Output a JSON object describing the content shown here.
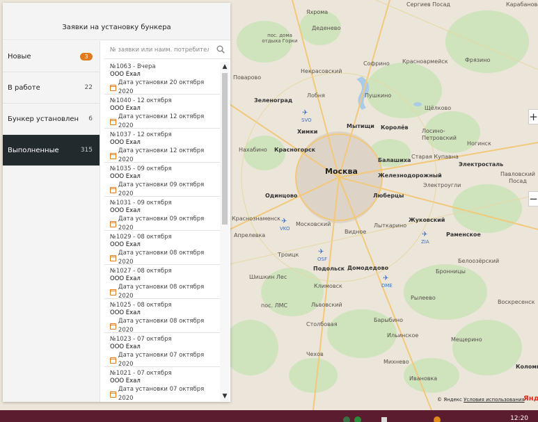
{
  "panel": {
    "title": "Заявки на установку бункера",
    "categories": [
      {
        "label": "Новые",
        "count": "3",
        "highlight": true
      },
      {
        "label": "В работе",
        "count": "22"
      },
      {
        "label": "Бункер установлен",
        "count": "6"
      },
      {
        "label": "Выполненные",
        "count": "315",
        "active": true
      }
    ],
    "search_placeholder": "№ заявки или наим. потребителя",
    "requests": [
      {
        "head": "№1063 - Вчера",
        "name": "ООО Exал",
        "date": "Дата установки 20 октября 2020"
      },
      {
        "head": "№1040 - 12 октября",
        "name": "ООО Exал",
        "date": "Дата установки 12 октября 2020"
      },
      {
        "head": "№1037 - 12 октября",
        "name": "ООО Exал",
        "date": "Дата установки 12 октября 2020"
      },
      {
        "head": "№1035 - 09 октября",
        "name": "ООО Exал",
        "date": "Дата установки 09 октября 2020"
      },
      {
        "head": "№1031 - 09 октября",
        "name": "ООО Exал",
        "date": "Дата установки 09 октября 2020"
      },
      {
        "head": "№1029 - 08 октября",
        "name": "ООО Exал",
        "date": "Дата установки 08 октября 2020"
      },
      {
        "head": "№1027 - 08 октября",
        "name": "ООО Exал",
        "date": "Дата установки 08 октября 2020"
      },
      {
        "head": "№1025 - 08 октября",
        "name": "ООО Exал",
        "date": "Дата установки 08 октября 2020"
      },
      {
        "head": "№1023 - 07 октября",
        "name": "ООО Exал",
        "date": "Дата установки 07 октября 2020"
      },
      {
        "head": "№1021 - 07 октября",
        "name": "ООО Exал",
        "date": "Дата установки 07 октября 2020"
      }
    ]
  },
  "map": {
    "labels": [
      {
        "text": "Яхрома",
        "cls": ""
      },
      {
        "text": "Сергиев Посад",
        "cls": ""
      },
      {
        "text": "Карабаново",
        "cls": ""
      },
      {
        "text": "Деденево",
        "cls": ""
      },
      {
        "text": "пос. дома отдыха Горки",
        "cls": ""
      },
      {
        "text": "Софрино",
        "cls": ""
      },
      {
        "text": "Красноармейск",
        "cls": ""
      },
      {
        "text": "Фрязино",
        "cls": ""
      },
      {
        "text": "Некрасовский",
        "cls": ""
      },
      {
        "text": "Поварово",
        "cls": ""
      },
      {
        "text": "Зеленоград",
        "cls": "town"
      },
      {
        "text": "Лобня",
        "cls": ""
      },
      {
        "text": "Пушкино",
        "cls": ""
      },
      {
        "text": "Щёлково",
        "cls": ""
      },
      {
        "text": "Химки",
        "cls": "town"
      },
      {
        "text": "Мытищи",
        "cls": "town"
      },
      {
        "text": "Королёв",
        "cls": "town"
      },
      {
        "text": "Лосино-Петровский",
        "cls": ""
      },
      {
        "text": "Ногинск",
        "cls": ""
      },
      {
        "text": "Нахабино",
        "cls": ""
      },
      {
        "text": "Красногорск",
        "cls": "town"
      },
      {
        "text": "Старая Купавна",
        "cls": ""
      },
      {
        "text": "Москва",
        "cls": "capital"
      },
      {
        "text": "Балашиха",
        "cls": "town"
      },
      {
        "text": "Электросталь",
        "cls": "town"
      },
      {
        "text": "Железнодорожный",
        "cls": "town"
      },
      {
        "text": "Электроугли",
        "cls": ""
      },
      {
        "text": "Павловский Посад",
        "cls": ""
      },
      {
        "text": "Одинцово",
        "cls": "town"
      },
      {
        "text": "Люберцы",
        "cls": "town"
      },
      {
        "text": "Краснознаменск",
        "cls": ""
      },
      {
        "text": "Московский",
        "cls": ""
      },
      {
        "text": "Видное",
        "cls": ""
      },
      {
        "text": "Лыткарино",
        "cls": ""
      },
      {
        "text": "Жуковский",
        "cls": "town"
      },
      {
        "text": "Раменское",
        "cls": "town"
      },
      {
        "text": "Апрелевка",
        "cls": ""
      },
      {
        "text": "Троицк",
        "cls": ""
      },
      {
        "text": "Подольск",
        "cls": "town"
      },
      {
        "text": "Домодедово",
        "cls": "town"
      },
      {
        "text": "Белоозёрский",
        "cls": ""
      },
      {
        "text": "Шишкин Лес",
        "cls": ""
      },
      {
        "text": "Бронницы",
        "cls": ""
      },
      {
        "text": "Климовск",
        "cls": ""
      },
      {
        "text": "пос. ЛМС",
        "cls": ""
      },
      {
        "text": "Львовский",
        "cls": ""
      },
      {
        "text": "Рылеево",
        "cls": ""
      },
      {
        "text": "Воскресенск",
        "cls": ""
      },
      {
        "text": "Барыбино",
        "cls": ""
      },
      {
        "text": "Столбовая",
        "cls": ""
      },
      {
        "text": "Ильинское",
        "cls": ""
      },
      {
        "text": "Мещерино",
        "cls": ""
      },
      {
        "text": "Чехов",
        "cls": ""
      },
      {
        "text": "Михнево",
        "cls": ""
      },
      {
        "text": "Коломна",
        "cls": "town"
      },
      {
        "text": "Ивановка",
        "cls": ""
      }
    ],
    "airports": [
      {
        "code": "SVO"
      },
      {
        "code": "VKO"
      },
      {
        "code": "ZIA"
      },
      {
        "code": "OSF"
      },
      {
        "code": "DME"
      }
    ],
    "attribution_prefix": "© Яндекс",
    "attribution_link": "Условия использования",
    "logo_text": "Янде",
    "zoom_in": "+",
    "zoom_out": "−"
  },
  "taskbar": {
    "clock": "12:20"
  },
  "colors": {
    "accent": "#e07a1a",
    "active_category": "#232a2e",
    "taskbar": "#5a1c2e"
  }
}
